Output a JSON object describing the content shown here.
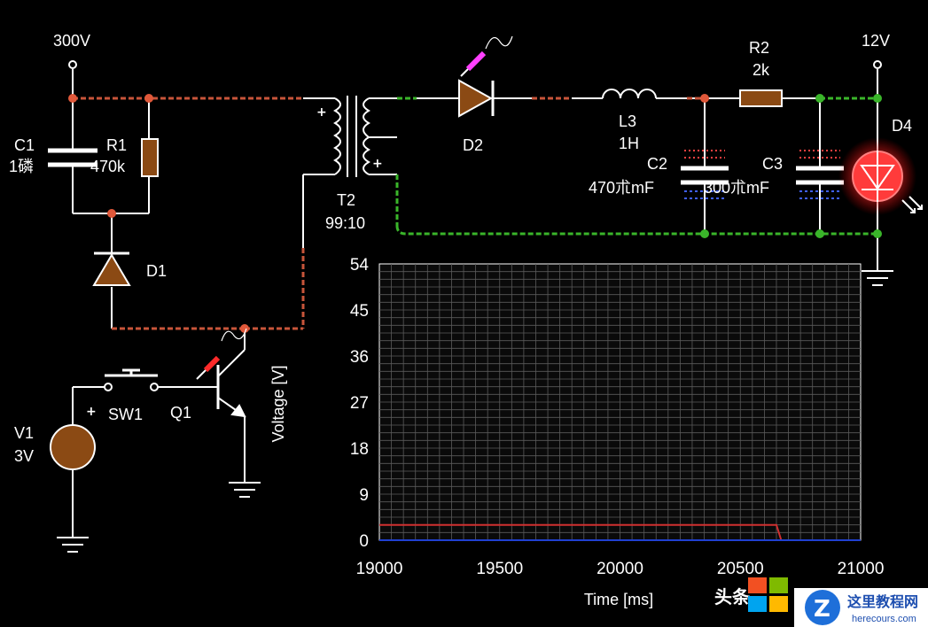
{
  "components": {
    "node_300v": "300V",
    "node_12v": "12V",
    "c1_name": "C1",
    "c1_value": "1磷",
    "r1_name": "R1",
    "r1_value": "470k",
    "d1_name": "D1",
    "t2_name": "T2",
    "t2_ratio": "99:10",
    "d2_name": "D2",
    "l3_name": "L3",
    "l3_value": "1H",
    "r2_name": "R2",
    "r2_value": "2k",
    "c2_name": "C2",
    "c2_value": "470朮mF",
    "c3_name": "C3",
    "c3_value": "300朮mF",
    "d4_name": "D4",
    "v1_name": "V1",
    "v1_value": "3V",
    "sw1_name": "SW1",
    "q1_name": "Q1",
    "plus_sign": "+"
  },
  "colors": {
    "wire": "#ffffff",
    "active_red": "#c8553a",
    "active_green": "#3ab52a",
    "component": "#8b4a14",
    "led_glow": "#ff3b3b"
  },
  "chart_data": {
    "type": "line",
    "xlabel": "Time [ms]",
    "ylabel": "Voltage [V]",
    "xlim": [
      19000,
      21000
    ],
    "ylim": [
      0,
      54
    ],
    "x_ticks": [
      "19000",
      "19500",
      "20000",
      "20500",
      "21000"
    ],
    "y_ticks": [
      "0",
      "9",
      "18",
      "27",
      "36",
      "45",
      "54"
    ],
    "grid": true,
    "series": [
      {
        "color": "#d03030",
        "points": [
          [
            19000,
            3
          ],
          [
            20650,
            3
          ],
          [
            20670,
            0
          ],
          [
            21000,
            0
          ]
        ]
      },
      {
        "color": "#2040d0",
        "points": [
          [
            19000,
            0
          ],
          [
            21000,
            0
          ]
        ]
      }
    ]
  },
  "watermark": {
    "text_left": "头条",
    "site_title": "这里教程网",
    "site_url": "herecours.com"
  }
}
